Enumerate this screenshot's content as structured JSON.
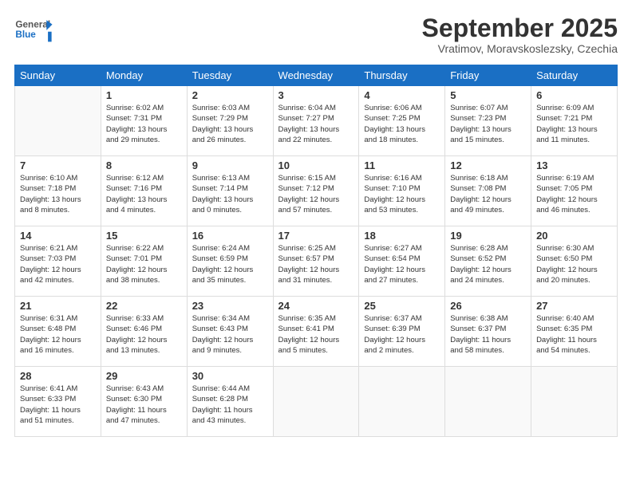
{
  "header": {
    "logo_general": "General",
    "logo_blue": "Blue",
    "month_title": "September 2025",
    "subtitle": "Vratimov, Moravskoslezsky, Czechia"
  },
  "weekdays": [
    "Sunday",
    "Monday",
    "Tuesday",
    "Wednesday",
    "Thursday",
    "Friday",
    "Saturday"
  ],
  "weeks": [
    [
      {
        "day": "",
        "info": ""
      },
      {
        "day": "1",
        "info": "Sunrise: 6:02 AM\nSunset: 7:31 PM\nDaylight: 13 hours\nand 29 minutes."
      },
      {
        "day": "2",
        "info": "Sunrise: 6:03 AM\nSunset: 7:29 PM\nDaylight: 13 hours\nand 26 minutes."
      },
      {
        "day": "3",
        "info": "Sunrise: 6:04 AM\nSunset: 7:27 PM\nDaylight: 13 hours\nand 22 minutes."
      },
      {
        "day": "4",
        "info": "Sunrise: 6:06 AM\nSunset: 7:25 PM\nDaylight: 13 hours\nand 18 minutes."
      },
      {
        "day": "5",
        "info": "Sunrise: 6:07 AM\nSunset: 7:23 PM\nDaylight: 13 hours\nand 15 minutes."
      },
      {
        "day": "6",
        "info": "Sunrise: 6:09 AM\nSunset: 7:21 PM\nDaylight: 13 hours\nand 11 minutes."
      }
    ],
    [
      {
        "day": "7",
        "info": "Sunrise: 6:10 AM\nSunset: 7:18 PM\nDaylight: 13 hours\nand 8 minutes."
      },
      {
        "day": "8",
        "info": "Sunrise: 6:12 AM\nSunset: 7:16 PM\nDaylight: 13 hours\nand 4 minutes."
      },
      {
        "day": "9",
        "info": "Sunrise: 6:13 AM\nSunset: 7:14 PM\nDaylight: 13 hours\nand 0 minutes."
      },
      {
        "day": "10",
        "info": "Sunrise: 6:15 AM\nSunset: 7:12 PM\nDaylight: 12 hours\nand 57 minutes."
      },
      {
        "day": "11",
        "info": "Sunrise: 6:16 AM\nSunset: 7:10 PM\nDaylight: 12 hours\nand 53 minutes."
      },
      {
        "day": "12",
        "info": "Sunrise: 6:18 AM\nSunset: 7:08 PM\nDaylight: 12 hours\nand 49 minutes."
      },
      {
        "day": "13",
        "info": "Sunrise: 6:19 AM\nSunset: 7:05 PM\nDaylight: 12 hours\nand 46 minutes."
      }
    ],
    [
      {
        "day": "14",
        "info": "Sunrise: 6:21 AM\nSunset: 7:03 PM\nDaylight: 12 hours\nand 42 minutes."
      },
      {
        "day": "15",
        "info": "Sunrise: 6:22 AM\nSunset: 7:01 PM\nDaylight: 12 hours\nand 38 minutes."
      },
      {
        "day": "16",
        "info": "Sunrise: 6:24 AM\nSunset: 6:59 PM\nDaylight: 12 hours\nand 35 minutes."
      },
      {
        "day": "17",
        "info": "Sunrise: 6:25 AM\nSunset: 6:57 PM\nDaylight: 12 hours\nand 31 minutes."
      },
      {
        "day": "18",
        "info": "Sunrise: 6:27 AM\nSunset: 6:54 PM\nDaylight: 12 hours\nand 27 minutes."
      },
      {
        "day": "19",
        "info": "Sunrise: 6:28 AM\nSunset: 6:52 PM\nDaylight: 12 hours\nand 24 minutes."
      },
      {
        "day": "20",
        "info": "Sunrise: 6:30 AM\nSunset: 6:50 PM\nDaylight: 12 hours\nand 20 minutes."
      }
    ],
    [
      {
        "day": "21",
        "info": "Sunrise: 6:31 AM\nSunset: 6:48 PM\nDaylight: 12 hours\nand 16 minutes."
      },
      {
        "day": "22",
        "info": "Sunrise: 6:33 AM\nSunset: 6:46 PM\nDaylight: 12 hours\nand 13 minutes."
      },
      {
        "day": "23",
        "info": "Sunrise: 6:34 AM\nSunset: 6:43 PM\nDaylight: 12 hours\nand 9 minutes."
      },
      {
        "day": "24",
        "info": "Sunrise: 6:35 AM\nSunset: 6:41 PM\nDaylight: 12 hours\nand 5 minutes."
      },
      {
        "day": "25",
        "info": "Sunrise: 6:37 AM\nSunset: 6:39 PM\nDaylight: 12 hours\nand 2 minutes."
      },
      {
        "day": "26",
        "info": "Sunrise: 6:38 AM\nSunset: 6:37 PM\nDaylight: 11 hours\nand 58 minutes."
      },
      {
        "day": "27",
        "info": "Sunrise: 6:40 AM\nSunset: 6:35 PM\nDaylight: 11 hours\nand 54 minutes."
      }
    ],
    [
      {
        "day": "28",
        "info": "Sunrise: 6:41 AM\nSunset: 6:33 PM\nDaylight: 11 hours\nand 51 minutes."
      },
      {
        "day": "29",
        "info": "Sunrise: 6:43 AM\nSunset: 6:30 PM\nDaylight: 11 hours\nand 47 minutes."
      },
      {
        "day": "30",
        "info": "Sunrise: 6:44 AM\nSunset: 6:28 PM\nDaylight: 11 hours\nand 43 minutes."
      },
      {
        "day": "",
        "info": ""
      },
      {
        "day": "",
        "info": ""
      },
      {
        "day": "",
        "info": ""
      },
      {
        "day": "",
        "info": ""
      }
    ]
  ]
}
